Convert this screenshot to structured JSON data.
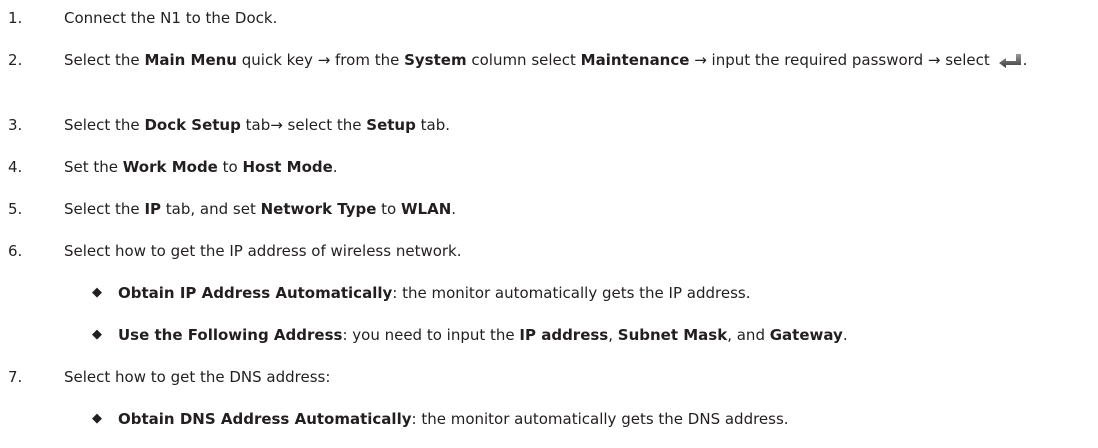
{
  "steps": [
    {
      "number": "1.",
      "segments": [
        {
          "text": "Connect the N1 to the Dock.",
          "bold": false
        }
      ]
    },
    {
      "number": "2.",
      "segments": [
        {
          "text": "Select the ",
          "bold": false
        },
        {
          "text": "Main Menu",
          "bold": true
        },
        {
          "text": " quick key → from the ",
          "bold": false
        },
        {
          "text": "System",
          "bold": true
        },
        {
          "text": " column select ",
          "bold": false
        },
        {
          "text": "Maintenance",
          "bold": true
        },
        {
          "text": " → input the required password → select ",
          "bold": false
        },
        {
          "icon": "enter-icon"
        },
        {
          "text": ".",
          "bold": false
        }
      ]
    },
    {
      "number": "3.",
      "segments": [
        {
          "text": "Select the ",
          "bold": false
        },
        {
          "text": "Dock Setup",
          "bold": true
        },
        {
          "text": " tab→ select the ",
          "bold": false
        },
        {
          "text": "Setup",
          "bold": true
        },
        {
          "text": " tab.",
          "bold": false
        }
      ]
    },
    {
      "number": "4.",
      "segments": [
        {
          "text": "Set the ",
          "bold": false
        },
        {
          "text": "Work Mode",
          "bold": true
        },
        {
          "text": " to ",
          "bold": false
        },
        {
          "text": "Host Mode",
          "bold": true
        },
        {
          "text": ".",
          "bold": false
        }
      ]
    },
    {
      "number": "5.",
      "segments": [
        {
          "text": "Select the ",
          "bold": false
        },
        {
          "text": "IP",
          "bold": true
        },
        {
          "text": " tab, and set ",
          "bold": false
        },
        {
          "text": "Network Type",
          "bold": true
        },
        {
          "text": " to ",
          "bold": false
        },
        {
          "text": "WLAN",
          "bold": true
        },
        {
          "text": ".",
          "bold": false
        }
      ]
    },
    {
      "number": "6.",
      "segments": [
        {
          "text": "Select how to get the IP address of wireless network.",
          "bold": false
        }
      ],
      "subitems": [
        {
          "bullet": "◆",
          "segments": [
            {
              "text": "Obtain IP Address Automatically",
              "bold": true
            },
            {
              "text": ": the monitor automatically gets the IP address.",
              "bold": false
            }
          ]
        },
        {
          "bullet": "◆",
          "segments": [
            {
              "text": "Use the Following Address",
              "bold": true
            },
            {
              "text": ": you need to input the ",
              "bold": false
            },
            {
              "text": "IP address",
              "bold": true
            },
            {
              "text": ", ",
              "bold": false
            },
            {
              "text": "Subnet Mask",
              "bold": true
            },
            {
              "text": ", and ",
              "bold": false
            },
            {
              "text": "Gateway",
              "bold": true
            },
            {
              "text": ".",
              "bold": false
            }
          ]
        }
      ]
    },
    {
      "number": "7.",
      "segments": [
        {
          "text": "Select how to get the DNS address:",
          "bold": false
        }
      ],
      "subitems": [
        {
          "bullet": "◆",
          "segments": [
            {
              "text": "Obtain DNS Address Automatically",
              "bold": true
            },
            {
              "text": ": the monitor automatically gets the DNS address.",
              "bold": false
            }
          ]
        }
      ]
    }
  ]
}
